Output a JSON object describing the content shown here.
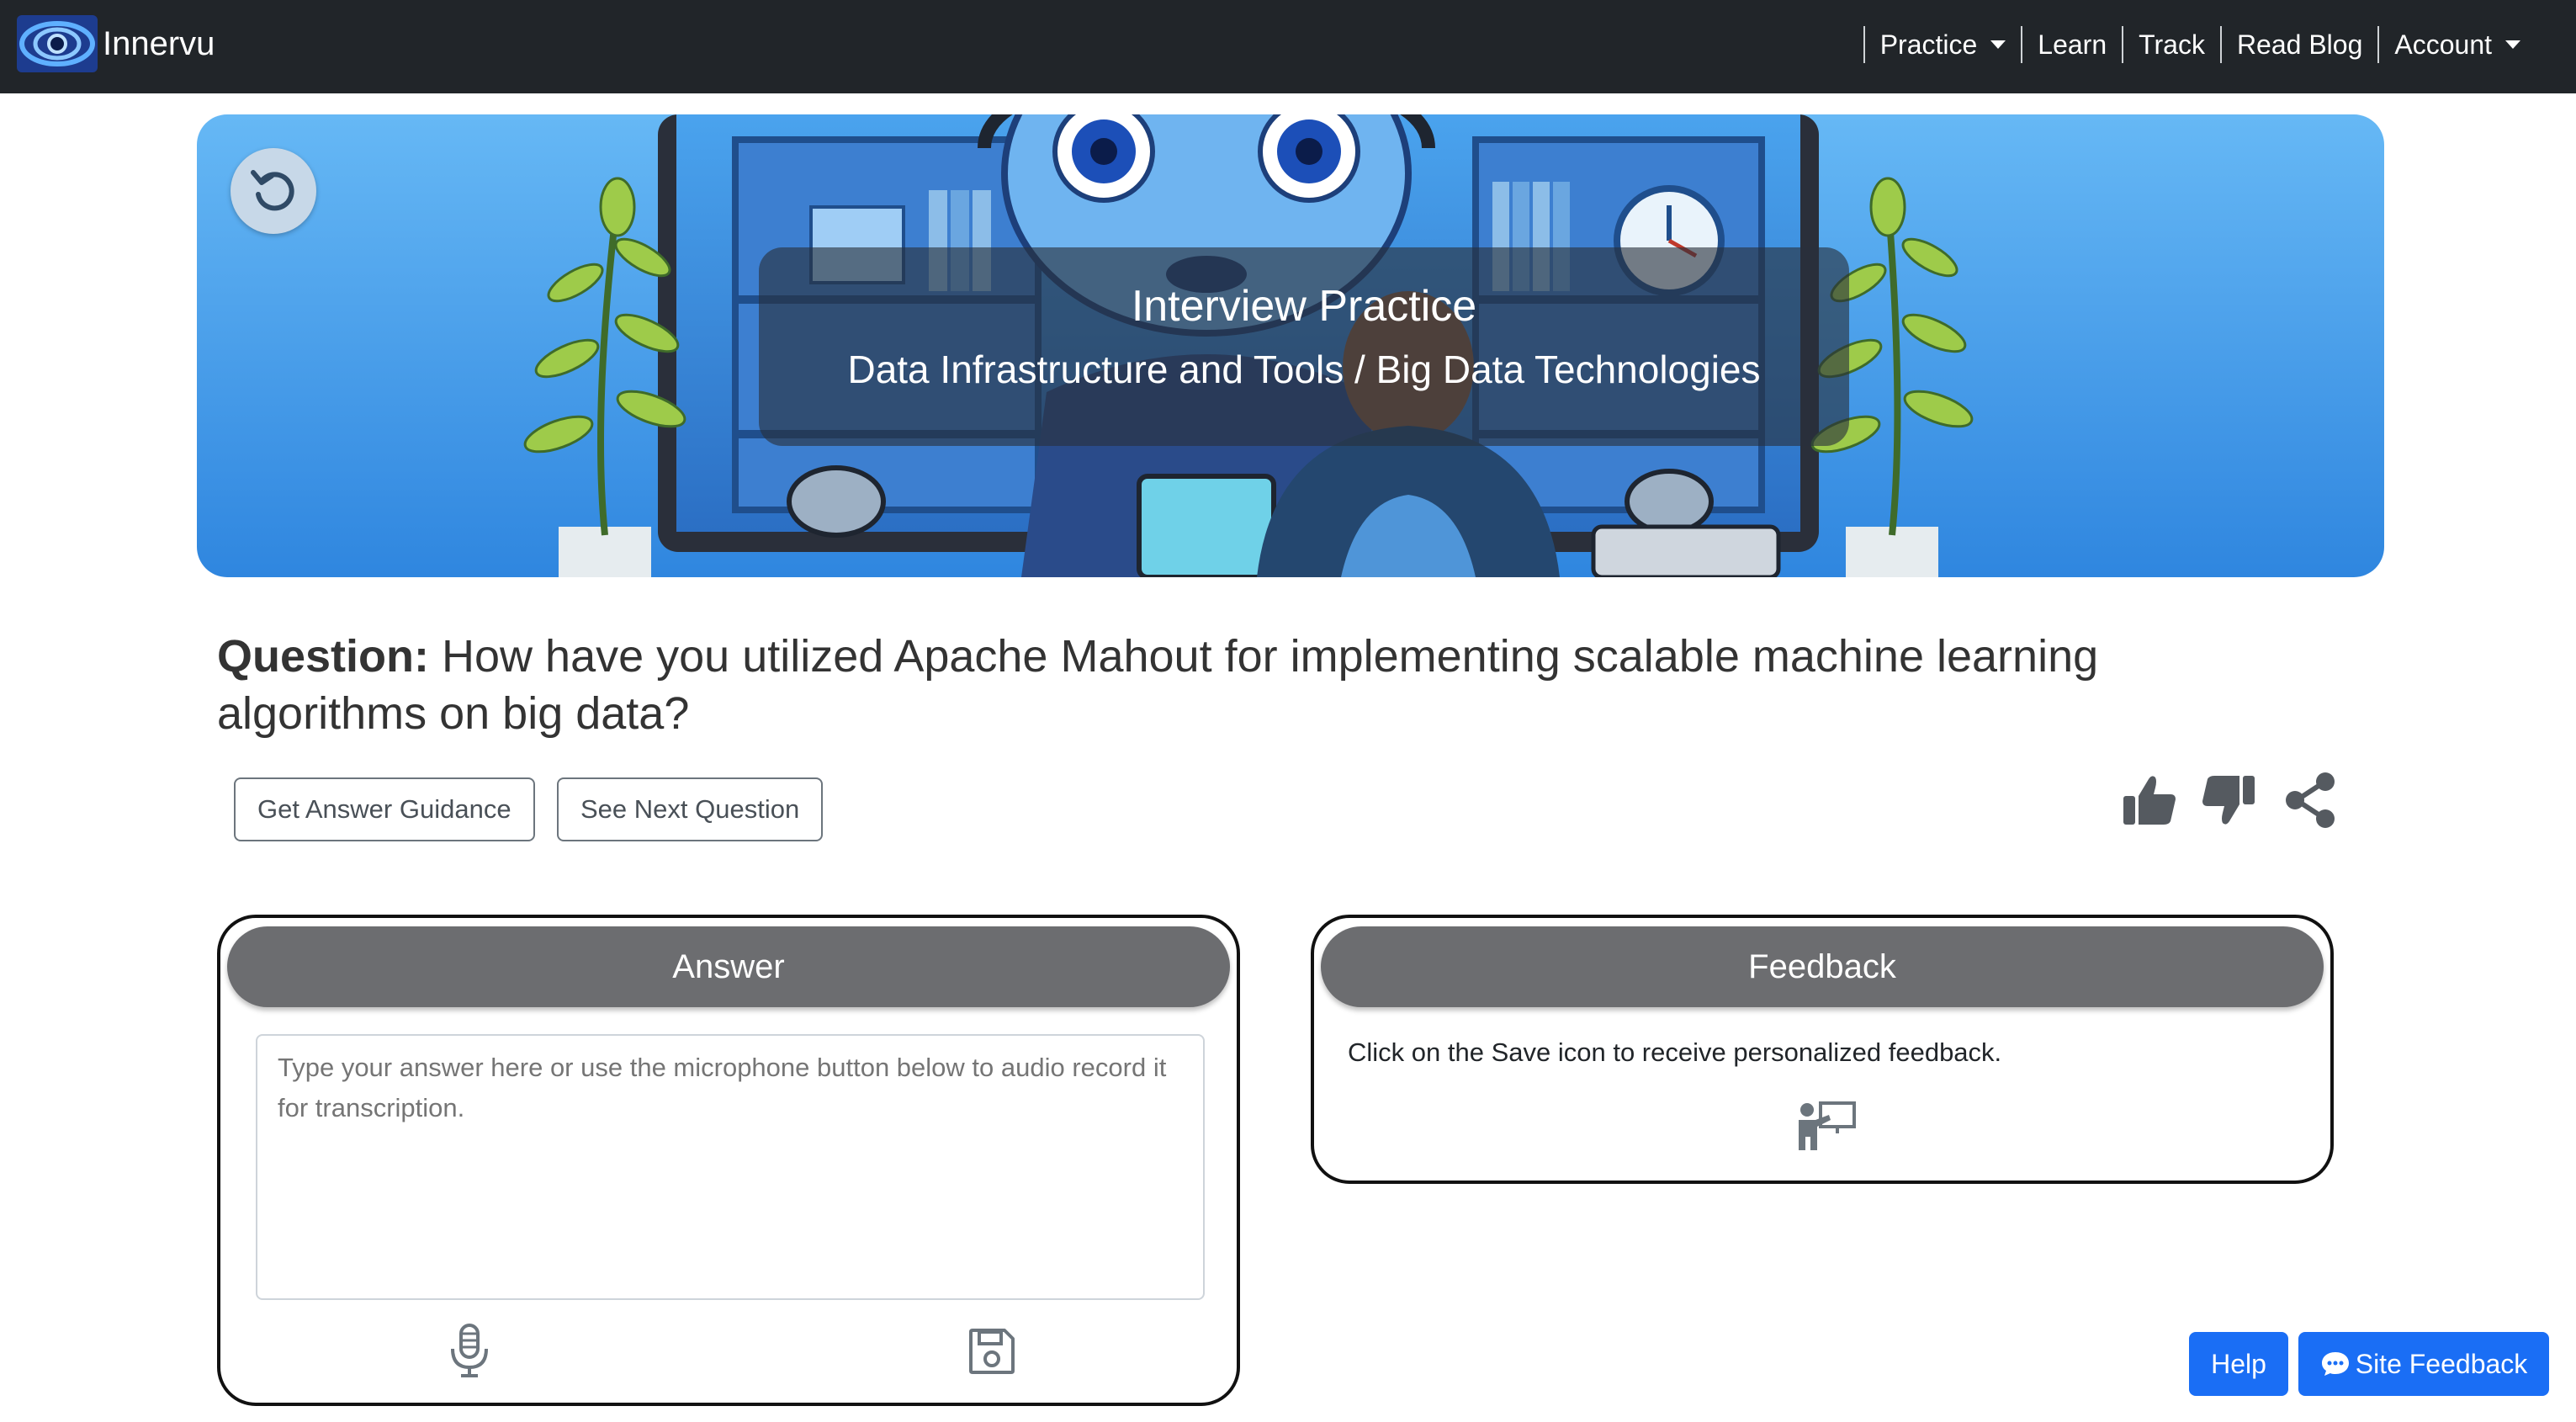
{
  "navbar": {
    "brand": "Innervu",
    "items": [
      {
        "label": "Practice",
        "dropdown": true
      },
      {
        "label": "Learn",
        "dropdown": false
      },
      {
        "label": "Track",
        "dropdown": false
      },
      {
        "label": "Read Blog",
        "dropdown": false
      },
      {
        "label": "Account",
        "dropdown": true
      }
    ]
  },
  "hero": {
    "title": "Interview Practice",
    "subtitle": "Data Infrastructure and Tools / Big Data Technologies"
  },
  "question": {
    "label": "Question:",
    "text": " How have you utilized Apache Mahout for implementing scalable machine learning algorithms on big data?"
  },
  "actions": {
    "guidance_label": "Get Answer Guidance",
    "next_label": "See Next Question"
  },
  "answer": {
    "header": "Answer",
    "placeholder": "Type your answer here or use the microphone button below to audio record it for transcription."
  },
  "feedback": {
    "header": "Feedback",
    "text": "Click on the Save icon to receive personalized feedback."
  },
  "floating": {
    "help_label": "Help",
    "site_feedback_label": "Site Feedback"
  },
  "colors": {
    "navbar": "#212529",
    "card_header": "#6c6d70",
    "primary": "#1a6ef5",
    "hero_sky": "#3a93e8"
  },
  "icons": [
    "eye-logo-icon",
    "caret-down-icon",
    "reset-icon",
    "thumbs-up-icon",
    "thumbs-down-icon",
    "share-icon",
    "microphone-icon",
    "save-icon",
    "presenter-icon",
    "chat-icon"
  ]
}
